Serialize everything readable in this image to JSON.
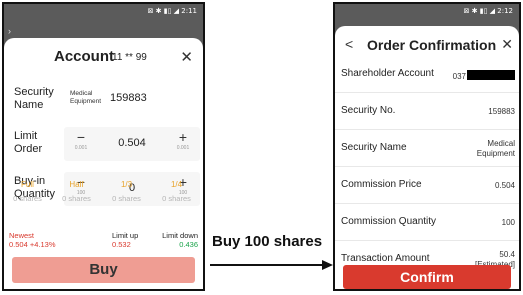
{
  "left_screen": {
    "status_bar": "⊠ ✱ ▮▯ ◢ 2:11",
    "title": "Account",
    "account_number": "11 ** 99",
    "close_icon": "✕",
    "security_label": "Security Name",
    "security_tag": "Medical Equipment",
    "security_code": "159883",
    "limit_order_label": "Limit Order",
    "limit_stepper": {
      "minus": "−",
      "minus_sub": "0.001",
      "value": "0.504",
      "plus": "+",
      "plus_sub": "0.001"
    },
    "quantity_label": "Buy-in Quantity",
    "quantity_stepper": {
      "minus": "−",
      "minus_sub": "100",
      "value": "0",
      "plus": "+",
      "plus_sub": "100"
    },
    "quick_options": [
      {
        "label": "Full",
        "shares": "0 shares"
      },
      {
        "label": "Half",
        "shares": "0 shares"
      },
      {
        "label": "1/3",
        "shares": "0 shares"
      },
      {
        "label": "1/4",
        "shares": "0 shares"
      }
    ],
    "newest": {
      "label": "Newest",
      "value": "0.504 +4.13%"
    },
    "limit_up": {
      "label": "Limit up",
      "value": "0.532"
    },
    "limit_down": {
      "label": "Limit down",
      "value": "0.436"
    },
    "buy_button": "Buy"
  },
  "arrow_label": "Buy 100 shares",
  "right_screen": {
    "status_bar": "⊠ ✱ ▮▯ ◢ 2:12",
    "back_icon": "<",
    "title": "Order Confirmation",
    "close_icon": "✕",
    "rows": [
      {
        "label": "Shareholder Account",
        "value": "037"
      },
      {
        "label": "Security No.",
        "value": "159883"
      },
      {
        "label": "Security Name",
        "value_line1": "Medical",
        "value_line2": "Equipment"
      },
      {
        "label": "Commission Price",
        "value": "0.504"
      },
      {
        "label": "Commission Quantity",
        "value": "100"
      },
      {
        "label": "Transaction Amount",
        "value_line1": "50.4",
        "value_line2": "[Estimated]"
      }
    ],
    "confirm_button": "Confirm"
  },
  "colors": {
    "gold": "#e8a32a",
    "red": "#d93a2e",
    "green": "#1aa34a",
    "buy_pink": "#ef9d93"
  }
}
